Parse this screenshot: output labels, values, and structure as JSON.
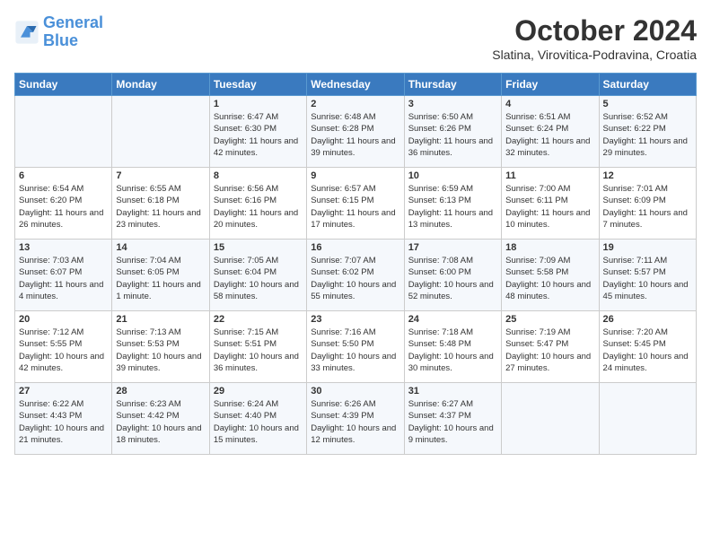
{
  "logo": {
    "line1": "General",
    "line2": "Blue"
  },
  "title": "October 2024",
  "subtitle": "Slatina, Virovitica-Podravina, Croatia",
  "headers": [
    "Sunday",
    "Monday",
    "Tuesday",
    "Wednesday",
    "Thursday",
    "Friday",
    "Saturday"
  ],
  "weeks": [
    [
      {
        "day": "",
        "info": ""
      },
      {
        "day": "",
        "info": ""
      },
      {
        "day": "1",
        "info": "Sunrise: 6:47 AM\nSunset: 6:30 PM\nDaylight: 11 hours and 42 minutes."
      },
      {
        "day": "2",
        "info": "Sunrise: 6:48 AM\nSunset: 6:28 PM\nDaylight: 11 hours and 39 minutes."
      },
      {
        "day": "3",
        "info": "Sunrise: 6:50 AM\nSunset: 6:26 PM\nDaylight: 11 hours and 36 minutes."
      },
      {
        "day": "4",
        "info": "Sunrise: 6:51 AM\nSunset: 6:24 PM\nDaylight: 11 hours and 32 minutes."
      },
      {
        "day": "5",
        "info": "Sunrise: 6:52 AM\nSunset: 6:22 PM\nDaylight: 11 hours and 29 minutes."
      }
    ],
    [
      {
        "day": "6",
        "info": "Sunrise: 6:54 AM\nSunset: 6:20 PM\nDaylight: 11 hours and 26 minutes."
      },
      {
        "day": "7",
        "info": "Sunrise: 6:55 AM\nSunset: 6:18 PM\nDaylight: 11 hours and 23 minutes."
      },
      {
        "day": "8",
        "info": "Sunrise: 6:56 AM\nSunset: 6:16 PM\nDaylight: 11 hours and 20 minutes."
      },
      {
        "day": "9",
        "info": "Sunrise: 6:57 AM\nSunset: 6:15 PM\nDaylight: 11 hours and 17 minutes."
      },
      {
        "day": "10",
        "info": "Sunrise: 6:59 AM\nSunset: 6:13 PM\nDaylight: 11 hours and 13 minutes."
      },
      {
        "day": "11",
        "info": "Sunrise: 7:00 AM\nSunset: 6:11 PM\nDaylight: 11 hours and 10 minutes."
      },
      {
        "day": "12",
        "info": "Sunrise: 7:01 AM\nSunset: 6:09 PM\nDaylight: 11 hours and 7 minutes."
      }
    ],
    [
      {
        "day": "13",
        "info": "Sunrise: 7:03 AM\nSunset: 6:07 PM\nDaylight: 11 hours and 4 minutes."
      },
      {
        "day": "14",
        "info": "Sunrise: 7:04 AM\nSunset: 6:05 PM\nDaylight: 11 hours and 1 minute."
      },
      {
        "day": "15",
        "info": "Sunrise: 7:05 AM\nSunset: 6:04 PM\nDaylight: 10 hours and 58 minutes."
      },
      {
        "day": "16",
        "info": "Sunrise: 7:07 AM\nSunset: 6:02 PM\nDaylight: 10 hours and 55 minutes."
      },
      {
        "day": "17",
        "info": "Sunrise: 7:08 AM\nSunset: 6:00 PM\nDaylight: 10 hours and 52 minutes."
      },
      {
        "day": "18",
        "info": "Sunrise: 7:09 AM\nSunset: 5:58 PM\nDaylight: 10 hours and 48 minutes."
      },
      {
        "day": "19",
        "info": "Sunrise: 7:11 AM\nSunset: 5:57 PM\nDaylight: 10 hours and 45 minutes."
      }
    ],
    [
      {
        "day": "20",
        "info": "Sunrise: 7:12 AM\nSunset: 5:55 PM\nDaylight: 10 hours and 42 minutes."
      },
      {
        "day": "21",
        "info": "Sunrise: 7:13 AM\nSunset: 5:53 PM\nDaylight: 10 hours and 39 minutes."
      },
      {
        "day": "22",
        "info": "Sunrise: 7:15 AM\nSunset: 5:51 PM\nDaylight: 10 hours and 36 minutes."
      },
      {
        "day": "23",
        "info": "Sunrise: 7:16 AM\nSunset: 5:50 PM\nDaylight: 10 hours and 33 minutes."
      },
      {
        "day": "24",
        "info": "Sunrise: 7:18 AM\nSunset: 5:48 PM\nDaylight: 10 hours and 30 minutes."
      },
      {
        "day": "25",
        "info": "Sunrise: 7:19 AM\nSunset: 5:47 PM\nDaylight: 10 hours and 27 minutes."
      },
      {
        "day": "26",
        "info": "Sunrise: 7:20 AM\nSunset: 5:45 PM\nDaylight: 10 hours and 24 minutes."
      }
    ],
    [
      {
        "day": "27",
        "info": "Sunrise: 6:22 AM\nSunset: 4:43 PM\nDaylight: 10 hours and 21 minutes."
      },
      {
        "day": "28",
        "info": "Sunrise: 6:23 AM\nSunset: 4:42 PM\nDaylight: 10 hours and 18 minutes."
      },
      {
        "day": "29",
        "info": "Sunrise: 6:24 AM\nSunset: 4:40 PM\nDaylight: 10 hours and 15 minutes."
      },
      {
        "day": "30",
        "info": "Sunrise: 6:26 AM\nSunset: 4:39 PM\nDaylight: 10 hours and 12 minutes."
      },
      {
        "day": "31",
        "info": "Sunrise: 6:27 AM\nSunset: 4:37 PM\nDaylight: 10 hours and 9 minutes."
      },
      {
        "day": "",
        "info": ""
      },
      {
        "day": "",
        "info": ""
      }
    ]
  ]
}
